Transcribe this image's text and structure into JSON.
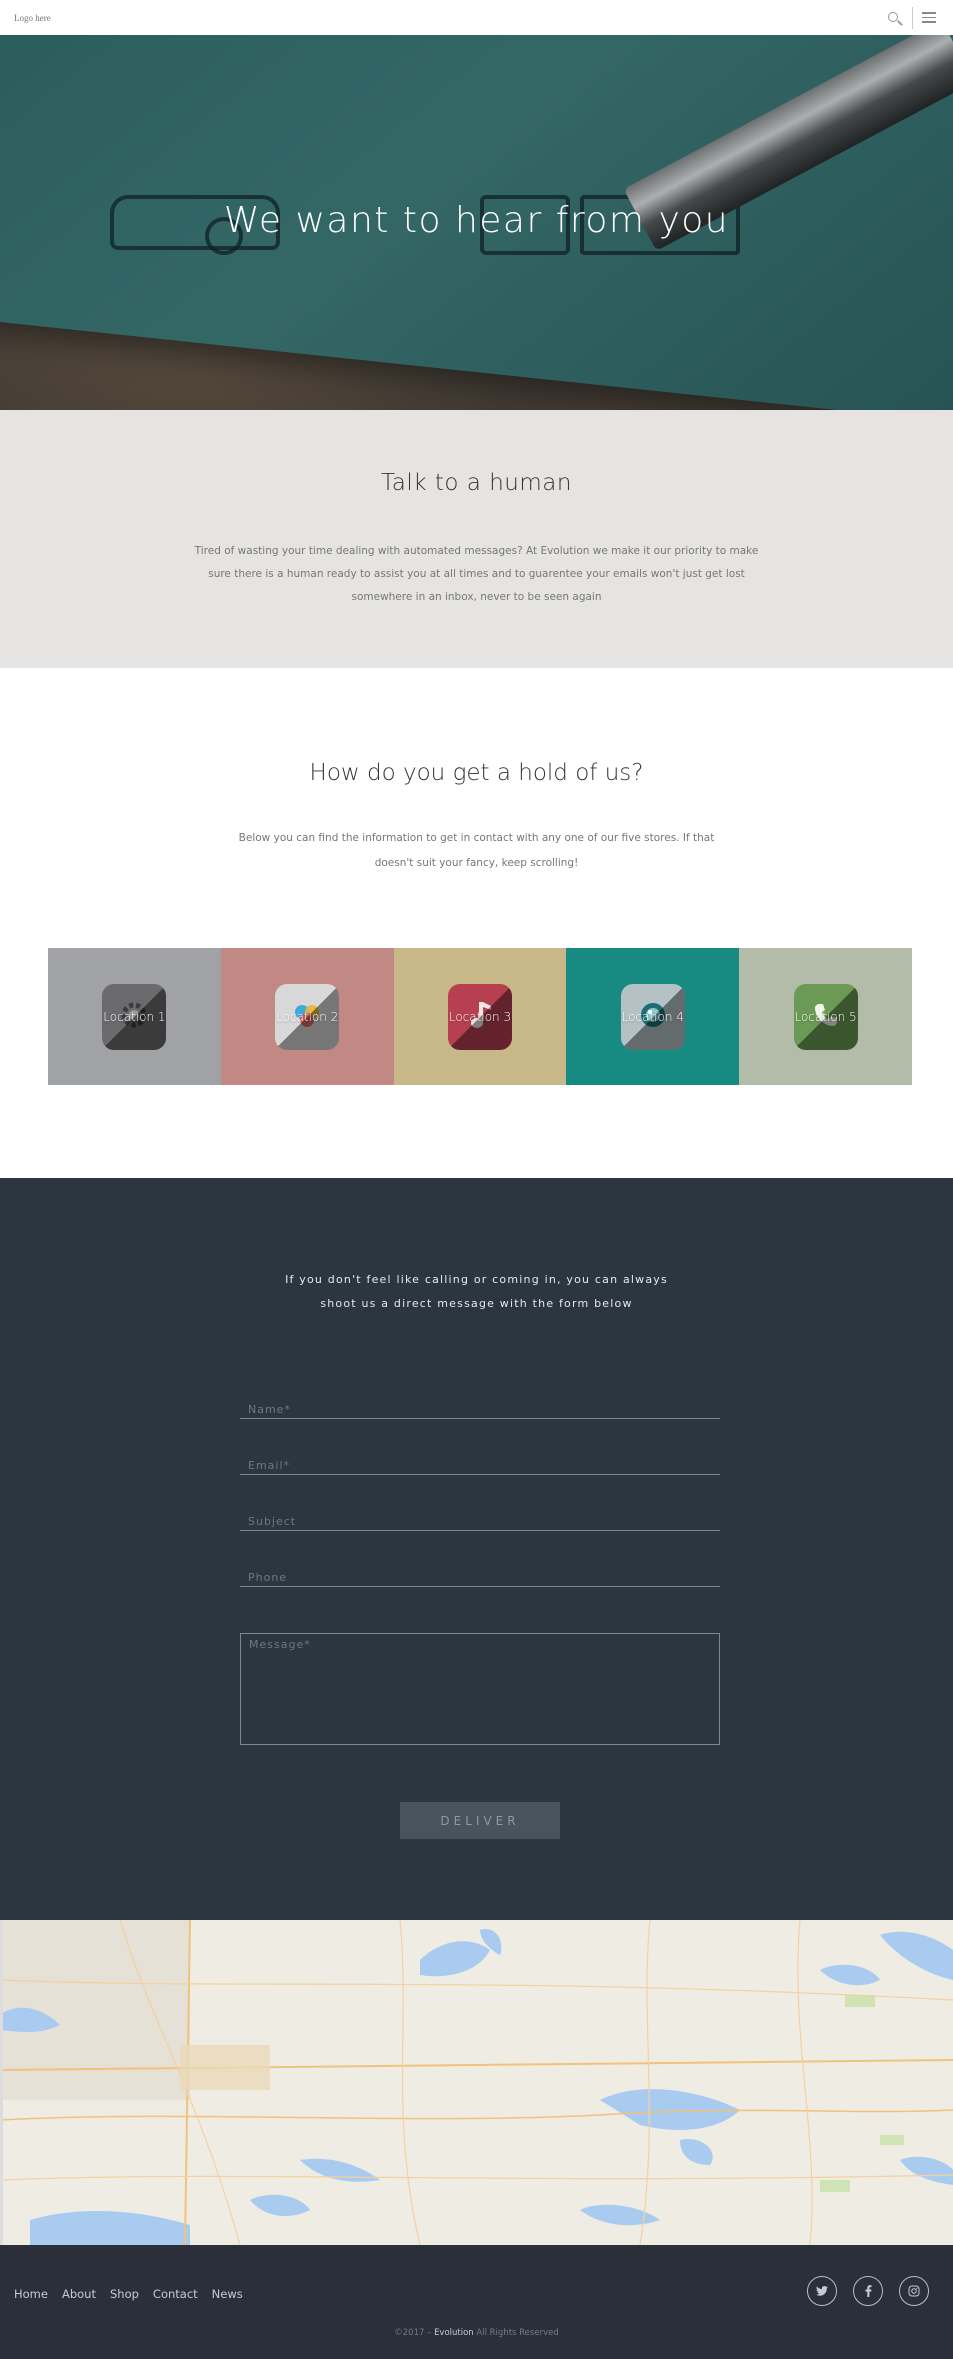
{
  "header": {
    "logo": "Logo here",
    "search_icon": "search-icon",
    "menu_icon": "hamburger-menu-icon"
  },
  "hero": {
    "title": "We want to hear from you"
  },
  "talk": {
    "title": "Talk to a human",
    "body": "Tired of wasting your time dealing with automated messages? At Evolution we make it our priority to make sure there is a human ready to assist you at all times and to guarentee your emails won't just get lost somewhere in an inbox, never to be seen again"
  },
  "hold": {
    "title": "How do you get a hold of us?",
    "body": "Below you can find the information to get in contact with any one of our five stores. If that doesn't suit your fancy, keep scrolling!",
    "locations": [
      {
        "label": "Location 1",
        "bg": "#a1a2a5",
        "icon": "settings-gear-icon",
        "app_color": "#6b6b6d"
      },
      {
        "label": "Location 2",
        "bg": "#c28883",
        "icon": "color-palette-icon",
        "app_color": "#d8d8d8"
      },
      {
        "label": "Location 3",
        "bg": "#c8b889",
        "icon": "music-note-icon",
        "app_color": "#b64050"
      },
      {
        "label": "Location 4",
        "bg": "#178a81",
        "icon": "camera-lens-icon",
        "app_color": "#b4c2c6"
      },
      {
        "label": "Location 5",
        "bg": "#b3bca9",
        "icon": "phone-icon",
        "app_color": "#6b9a56"
      }
    ]
  },
  "contact": {
    "intro": "If you don't feel like calling or coming in, you can always shoot us a direct message with the form below",
    "fields": {
      "name": "Name*",
      "email": "Email*",
      "subject": "Subject",
      "phone": "Phone",
      "message": "Message*"
    },
    "submit_label": "DELIVER"
  },
  "footer": {
    "nav": [
      "Home",
      "About",
      "Shop",
      "Contact",
      "News"
    ],
    "social": [
      "twitter-icon",
      "facebook-icon",
      "instagram-icon"
    ],
    "copyright_prefix": "©2017 – ",
    "brand": "Evolution",
    "copyright_suffix": " All Rights Reserved"
  }
}
